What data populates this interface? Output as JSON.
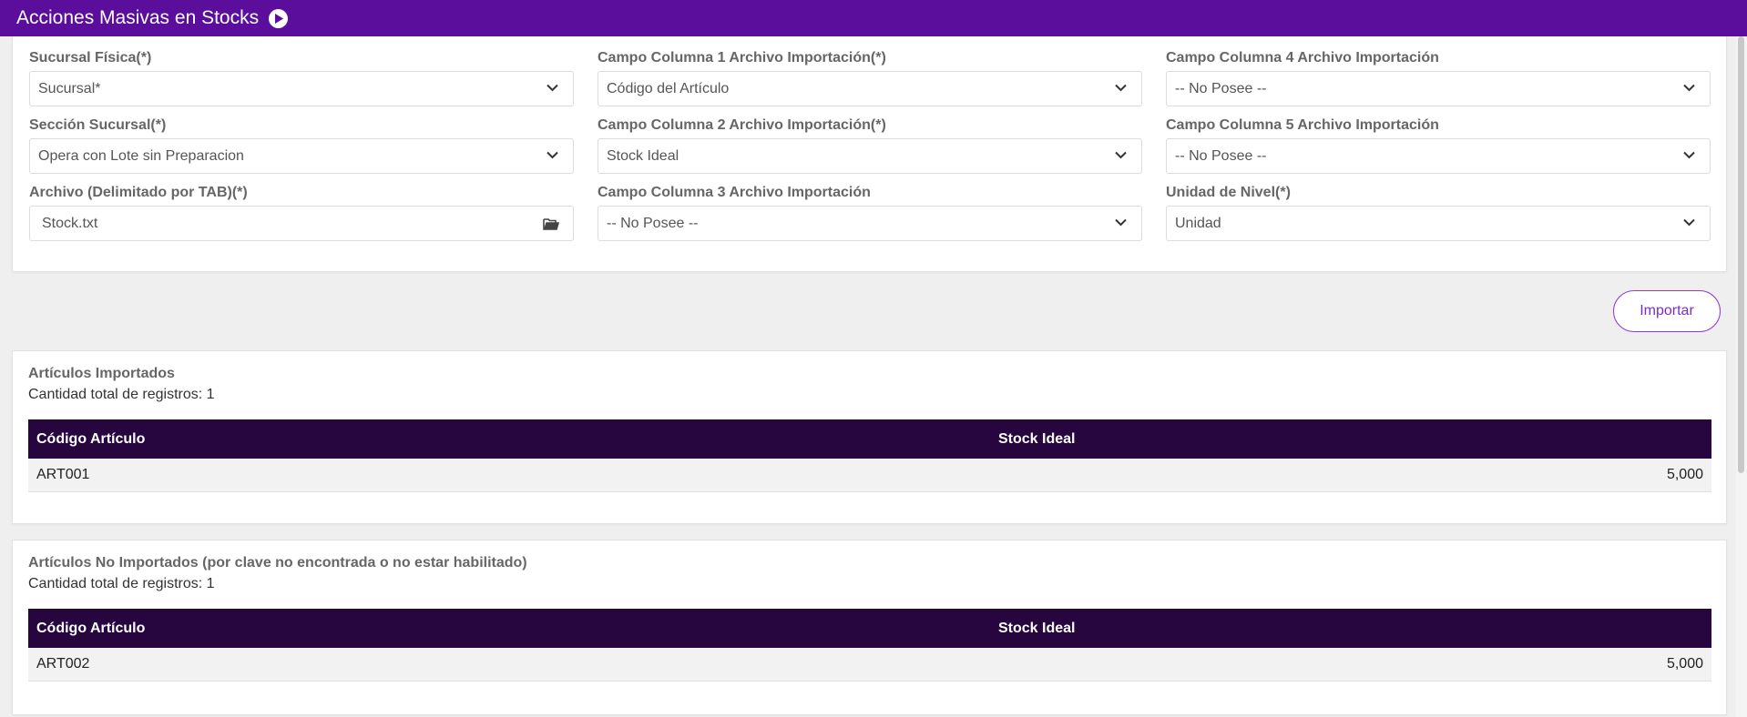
{
  "header": {
    "title": "Acciones Masivas en Stocks",
    "color": "#5a0e9b"
  },
  "form": {
    "col1": [
      {
        "label": "Sucursal Física(*)",
        "value": "Sucursal*"
      },
      {
        "label": "Sección Sucursal(*)",
        "value": "Opera con Lote sin Preparacion"
      },
      {
        "label": "Archivo (Delimitado por TAB)(*)",
        "value": "Stock.txt"
      }
    ],
    "col2": [
      {
        "label": "Campo Columna 1 Archivo Importación(*)",
        "value": "Código del Artículo"
      },
      {
        "label": "Campo Columna 2 Archivo Importación(*)",
        "value": "Stock Ideal"
      },
      {
        "label": "Campo Columna 3 Archivo Importación",
        "value": "-- No Posee --"
      }
    ],
    "col3": [
      {
        "label": "Campo Columna 4 Archivo Importación",
        "value": "-- No Posee --"
      },
      {
        "label": "Campo Columna 5 Archivo Importación",
        "value": "-- No Posee --"
      },
      {
        "label": "Unidad de Nivel(*)",
        "value": "Unidad"
      }
    ]
  },
  "actions": {
    "import_label": "Importar"
  },
  "imported": {
    "title": "Artículos Importados",
    "count_text": "Cantidad total de registros: 1",
    "columns": [
      "Código Artículo",
      "Stock Ideal"
    ],
    "rows": [
      {
        "code": "ART001",
        "stock": "5,000"
      }
    ]
  },
  "not_imported": {
    "title": "Artículos No Importados (por clave no encontrada o no estar habilitado)",
    "count_text": "Cantidad total de registros: 1",
    "columns": [
      "Código Artículo",
      "Stock Ideal"
    ],
    "rows": [
      {
        "code": "ART002",
        "stock": "5,000"
      }
    ]
  },
  "colors": {
    "table_header": "#27063f",
    "accent": "#7d2cc8"
  }
}
